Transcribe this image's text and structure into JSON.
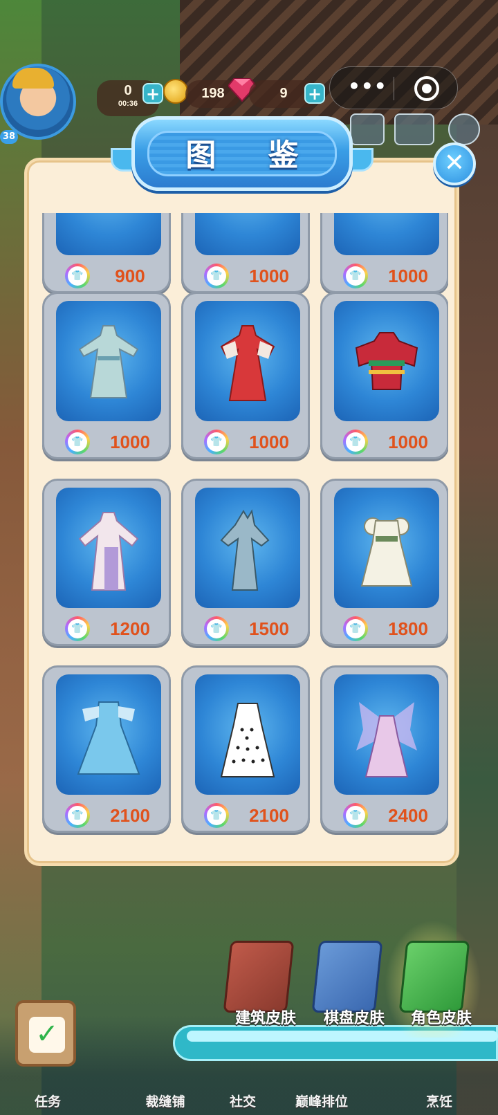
{
  "hud": {
    "level": "38",
    "energy_value": "0",
    "energy_timer": "00:36",
    "coins_value": "198",
    "gems_value": "9"
  },
  "miniprogram_capsule": {
    "more_icon": "more-dots-icon",
    "close_icon": "target-icon"
  },
  "modal": {
    "title": "图 鉴",
    "close_icon": "close-icon"
  },
  "cards": [
    {
      "price": "900"
    },
    {
      "price": "1000"
    },
    {
      "price": "1000"
    },
    {
      "price": "1000"
    },
    {
      "price": "1000"
    },
    {
      "price": "1000"
    },
    {
      "price": "1200"
    },
    {
      "price": "1500"
    },
    {
      "price": "1800"
    },
    {
      "price": "2100"
    },
    {
      "price": "2100"
    },
    {
      "price": "2400"
    }
  ],
  "tabs": [
    {
      "label": "建筑皮肤"
    },
    {
      "label": "棋盘皮肤"
    },
    {
      "label": "角色皮肤"
    }
  ],
  "nav": [
    {
      "label": "任务"
    },
    {
      "label": "裁缝铺"
    },
    {
      "label": "社交"
    },
    {
      "label": "巅峰排位"
    },
    {
      "label": "烹饪"
    }
  ],
  "colors": {
    "price_text": "#e0521c",
    "card_bg": "#bcc4cf",
    "modal_bg": "#fbeed8",
    "header_blue": "#3a9ee6"
  }
}
